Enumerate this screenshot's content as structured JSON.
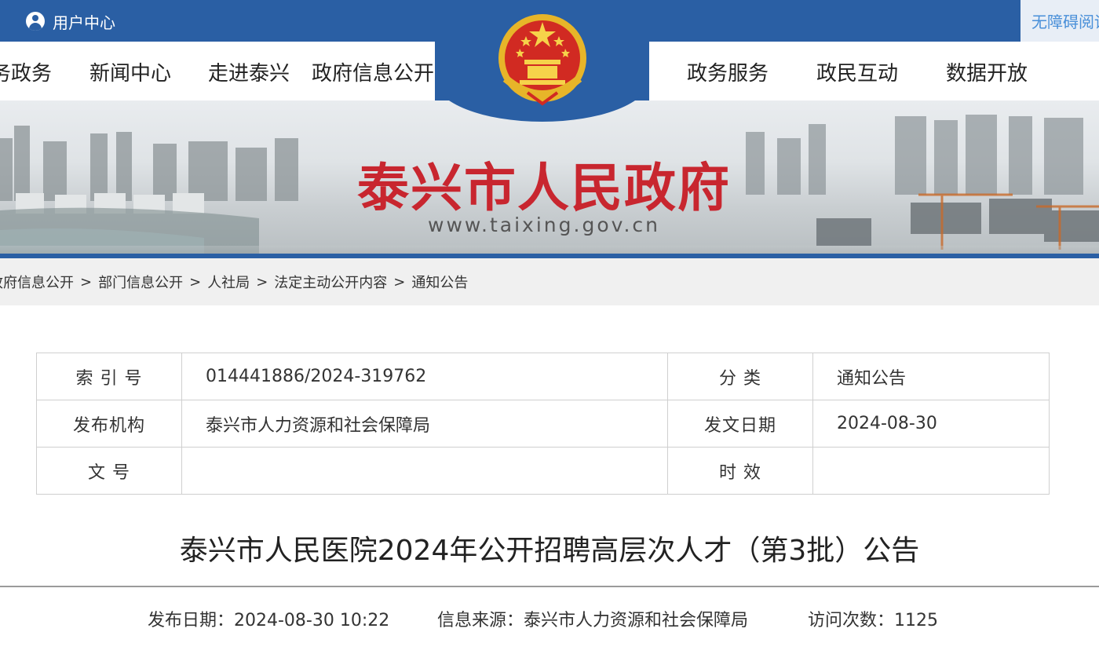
{
  "topbar": {
    "user_center": "用户中心",
    "accessibility": "无障碍阅读"
  },
  "nav": {
    "left_items": [
      "务政务",
      "新闻中心",
      "走进泰兴",
      "政府信息公开"
    ],
    "right_items": [
      "政务服务",
      "政民互动",
      "数据开放"
    ]
  },
  "banner": {
    "title": "泰兴市人民政府",
    "url": "www.taixing.gov.cn"
  },
  "breadcrumb": [
    "政府信息公开",
    "部门信息公开",
    "人社局",
    "法定主动公开内容",
    "通知公告"
  ],
  "info": {
    "index_label": "索 引 号",
    "index_value": "014441886/2024-319762",
    "category_label": "分 类",
    "category_value": "通知公告",
    "publisher_label": "发布机构",
    "publisher_value": "泰兴市人力资源和社会保障局",
    "date_label": "发文日期",
    "date_value": "2024-08-30",
    "docno_label": "文 号",
    "docno_value": "",
    "validity_label": "时 效",
    "validity_value": ""
  },
  "article": {
    "title": "泰兴市人民医院2024年公开招聘高层次人才（第3批）公告",
    "publish_date": "发布日期：2024-08-30 10:22",
    "source": "信息来源：泰兴市人力资源和社会保障局",
    "visits": "访问次数：1125"
  },
  "colors": {
    "primary_blue": "#2a5fa4",
    "banner_red": "#c8262f",
    "emblem_gold": "#f2c230"
  }
}
